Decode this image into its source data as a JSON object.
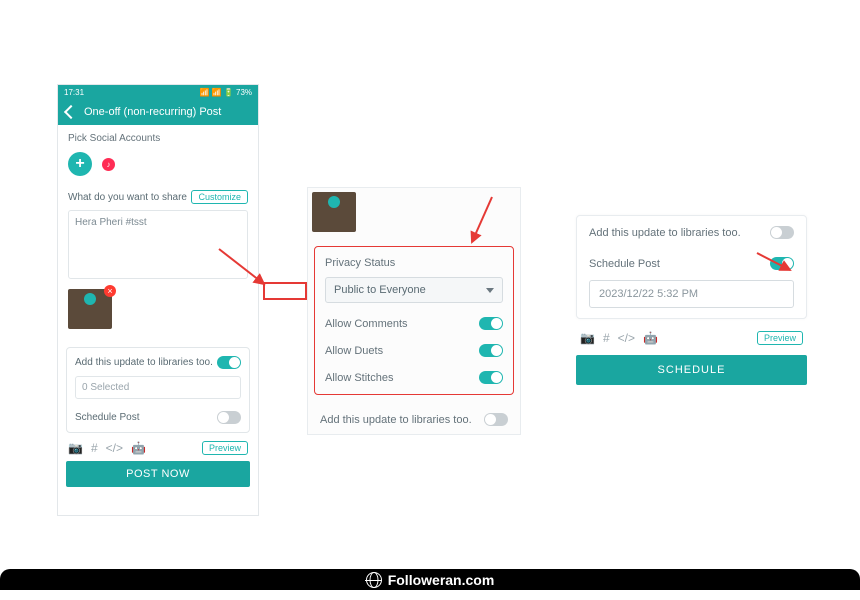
{
  "footer": {
    "site": "Followeran.com"
  },
  "p1": {
    "status": {
      "time": "17:31",
      "indicators": "📶 📶 🔋 73%"
    },
    "appbar": {
      "title": "One-off (non-recurring) Post"
    },
    "pick_label": "Pick Social Accounts",
    "share_label": "What do you want to share",
    "customize": "Customize",
    "caption": "Hera Pheri #tsst",
    "lib_label": "Add this update to libraries too.",
    "selected": "0 Selected",
    "schedule_label": "Schedule Post",
    "preview": "Preview",
    "post_now": "POST NOW"
  },
  "p2": {
    "privacy_label": "Privacy Status",
    "privacy_value": "Public to Everyone",
    "allow_comments": "Allow Comments",
    "allow_duets": "Allow Duets",
    "allow_stitches": "Allow Stitches",
    "lib_label": "Add this update to libraries too."
  },
  "p3": {
    "lib_label": "Add this update to libraries too.",
    "schedule_label": "Schedule Post",
    "datetime": "2023/12/22 5:32 PM",
    "preview": "Preview",
    "schedule_btn": "SCHEDULE"
  }
}
